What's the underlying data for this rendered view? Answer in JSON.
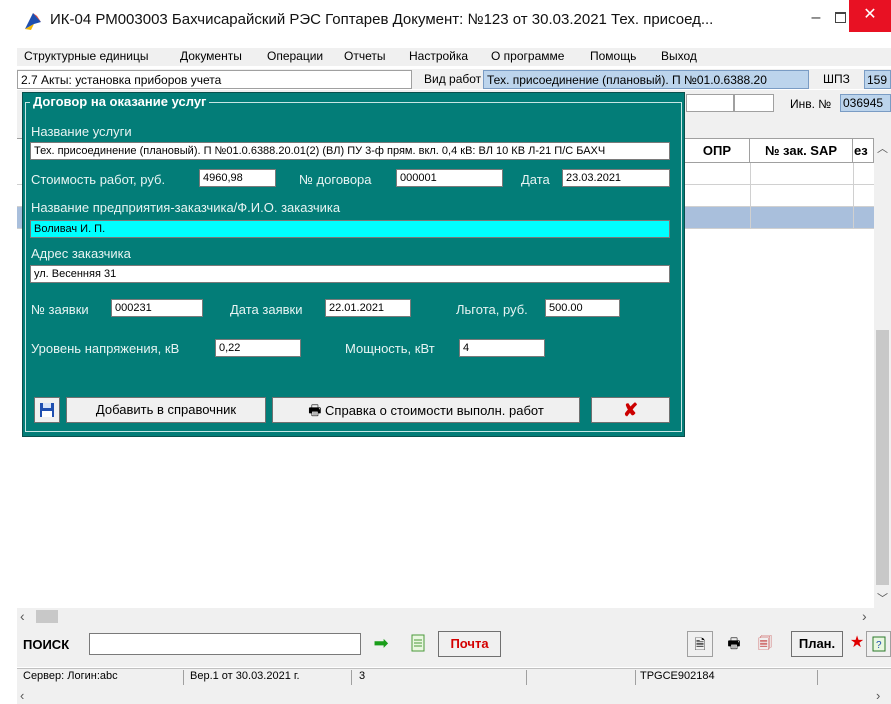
{
  "window": {
    "title": "ИК-04 РМ003003 Бахчисарайский РЭС Гоптарев Документ: №123 от 30.03.2021   Тех. присоед..."
  },
  "menu": [
    "Структурные единицы",
    "Документы",
    "Операции",
    "Отчеты",
    "Настройка",
    "О программе",
    "Помощь",
    "Выход"
  ],
  "toprow": {
    "act": "2.7  Акты: установка приборов учета",
    "vid_label": "Вид работ",
    "vid_value": "Тех. присоединение (плановый). П №01.0.6388.20",
    "shpz_label": "ШПЗ",
    "shpz_value": "159",
    "inv_label": "Инв. №",
    "inv_value": "036945"
  },
  "grid": {
    "columns": [
      "ОПР",
      "№ зак. SAP",
      "ез"
    ]
  },
  "dialog": {
    "title": "Договор на оказание услуг",
    "service_label": "Название услуги",
    "service_value": "Тех. присоединение (плановый). П №01.0.6388.20.01(2) (ВЛ) ПУ 3-ф прям. вкл. 0,4 кВ: ВЛ 10 КВ Л-21 П/С БАХЧ",
    "cost_label": "Стоимость работ, руб.",
    "cost_value": "4960,98",
    "contract_label": "№ договора",
    "contract_value": "000001",
    "date_label": "Дата",
    "date_value": "23.03.2021",
    "customer_label": "Название предприятия-заказчика/Ф.И.О. заказчика",
    "customer_value": "Воливач И. П.",
    "address_label": "Адрес заказчика",
    "address_value": "ул. Весенняя 31",
    "request_label": "№ заявки",
    "request_value": "000231",
    "request_date_label": "Дата заявки",
    "request_date_value": "22.01.2021",
    "benefit_label": "Льгота, руб.",
    "benefit_value": "500.00",
    "voltage_label": "Уровень напряжения, кВ",
    "voltage_value": "0,22",
    "power_label": "Мощность, кВт",
    "power_value": "4",
    "add_button": "Добавить в справочник",
    "cert_button": "Справка о стоимости выполн. работ"
  },
  "toolbar": {
    "search_label": "ПОИСК",
    "search_placeholder": "",
    "mail_button": "Почта",
    "plan_button": "План."
  },
  "status": {
    "server": "Сервер:  Логин:abc",
    "version": "Вер.1 от 30.03.2021 г.",
    "count": "3",
    "host": "TPGCE902184"
  },
  "colors": {
    "dialog_bg": "#037d78",
    "customer_field": "#00ffff",
    "mail_text": "#d40000",
    "close_red": "#e81123"
  }
}
